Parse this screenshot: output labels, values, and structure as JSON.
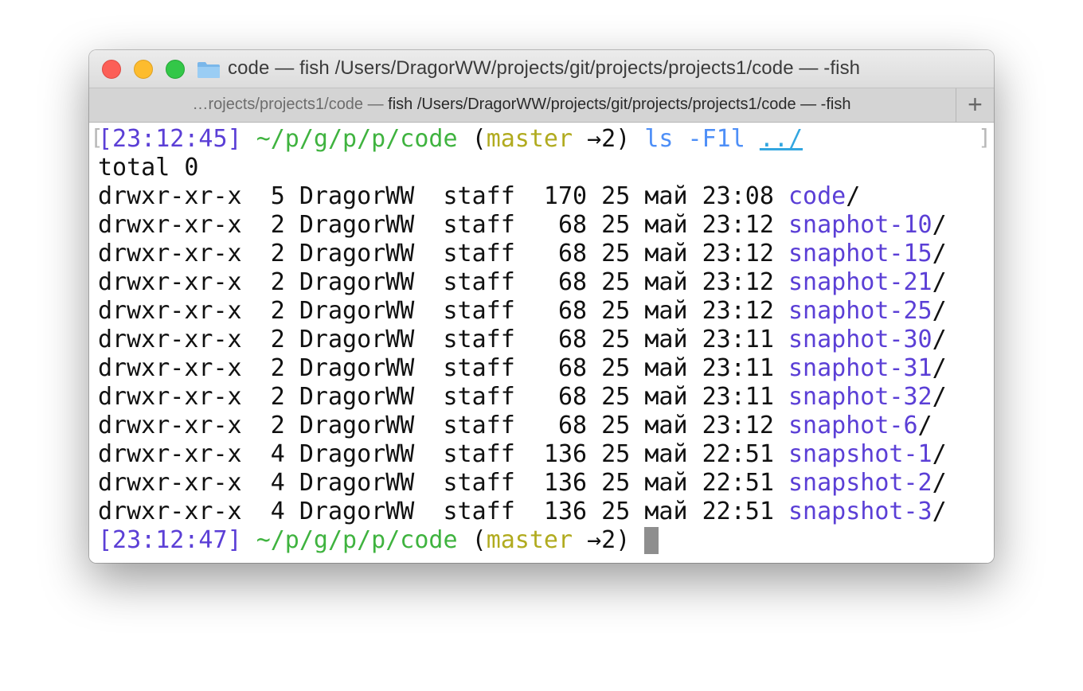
{
  "window": {
    "title": "code — fish  /Users/DragorWW/projects/git/projects/projects1/code — -fish"
  },
  "tab": {
    "prefix": "…rojects/projects1/code — ",
    "label": "fish  /Users/DragorWW/projects/git/projects/projects1/code — -fish",
    "new_tab_symbol": "+"
  },
  "terminal": {
    "prompt1": {
      "time": "[23:12:45]",
      "path": "~/p/g/p/p/code",
      "open_paren": "(",
      "branch": "master",
      "ahead": "→2)",
      "command": "ls -F1l",
      "argument": "../"
    },
    "total_line": "total 0",
    "entries": [
      {
        "perms": "drwxr-xr-x",
        "links": "5",
        "owner": "DragorWW",
        "group": "staff",
        "size": "170",
        "day": "25",
        "month": "май",
        "time": "23:08",
        "name": "code"
      },
      {
        "perms": "drwxr-xr-x",
        "links": "2",
        "owner": "DragorWW",
        "group": "staff",
        "size": "68",
        "day": "25",
        "month": "май",
        "time": "23:12",
        "name": "snaphot-10"
      },
      {
        "perms": "drwxr-xr-x",
        "links": "2",
        "owner": "DragorWW",
        "group": "staff",
        "size": "68",
        "day": "25",
        "month": "май",
        "time": "23:12",
        "name": "snaphot-15"
      },
      {
        "perms": "drwxr-xr-x",
        "links": "2",
        "owner": "DragorWW",
        "group": "staff",
        "size": "68",
        "day": "25",
        "month": "май",
        "time": "23:12",
        "name": "snaphot-21"
      },
      {
        "perms": "drwxr-xr-x",
        "links": "2",
        "owner": "DragorWW",
        "group": "staff",
        "size": "68",
        "day": "25",
        "month": "май",
        "time": "23:12",
        "name": "snaphot-25"
      },
      {
        "perms": "drwxr-xr-x",
        "links": "2",
        "owner": "DragorWW",
        "group": "staff",
        "size": "68",
        "day": "25",
        "month": "май",
        "time": "23:11",
        "name": "snaphot-30"
      },
      {
        "perms": "drwxr-xr-x",
        "links": "2",
        "owner": "DragorWW",
        "group": "staff",
        "size": "68",
        "day": "25",
        "month": "май",
        "time": "23:11",
        "name": "snaphot-31"
      },
      {
        "perms": "drwxr-xr-x",
        "links": "2",
        "owner": "DragorWW",
        "group": "staff",
        "size": "68",
        "day": "25",
        "month": "май",
        "time": "23:11",
        "name": "snaphot-32"
      },
      {
        "perms": "drwxr-xr-x",
        "links": "2",
        "owner": "DragorWW",
        "group": "staff",
        "size": "68",
        "day": "25",
        "month": "май",
        "time": "23:12",
        "name": "snaphot-6"
      },
      {
        "perms": "drwxr-xr-x",
        "links": "4",
        "owner": "DragorWW",
        "group": "staff",
        "size": "136",
        "day": "25",
        "month": "май",
        "time": "22:51",
        "name": "snapshot-1"
      },
      {
        "perms": "drwxr-xr-x",
        "links": "4",
        "owner": "DragorWW",
        "group": "staff",
        "size": "136",
        "day": "25",
        "month": "май",
        "time": "22:51",
        "name": "snapshot-2"
      },
      {
        "perms": "drwxr-xr-x",
        "links": "4",
        "owner": "DragorWW",
        "group": "staff",
        "size": "136",
        "day": "25",
        "month": "май",
        "time": "22:51",
        "name": "snapshot-3"
      }
    ],
    "dir_suffix": "/",
    "prompt2": {
      "time": "[23:12:47]",
      "path": "~/p/g/p/p/code",
      "open_paren": "(",
      "branch": "master",
      "ahead": "→2)"
    }
  }
}
